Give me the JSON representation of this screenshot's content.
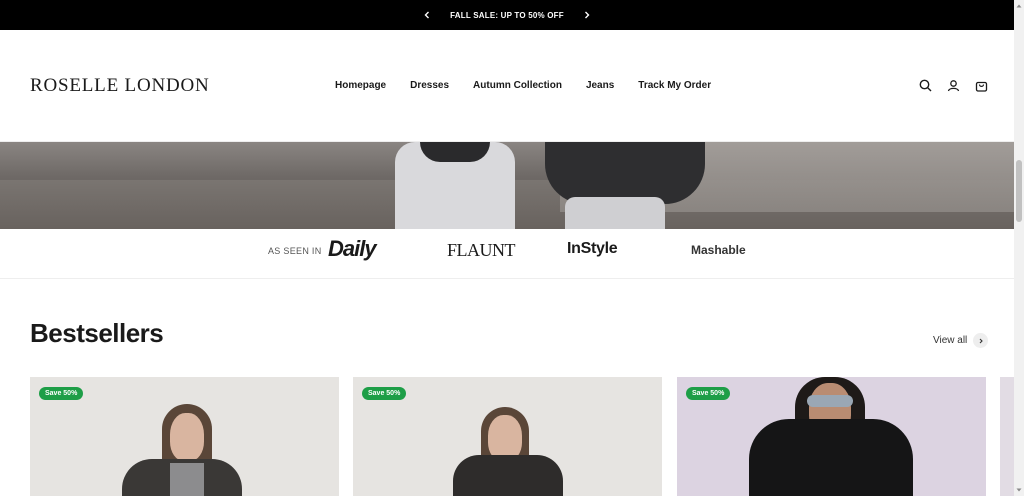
{
  "announcement": {
    "text": "FALL SALE: UP TO 50% OFF",
    "prev_icon": "chevron-left-icon",
    "next_icon": "chevron-right-icon"
  },
  "header": {
    "logo": "ROSELLE LONDON",
    "nav": [
      "Homepage",
      "Dresses",
      "Autumn Collection",
      "Jeans",
      "Track My Order"
    ],
    "icons": [
      "search-icon",
      "account-icon",
      "cart-icon"
    ]
  },
  "press": {
    "label": "AS SEEN IN",
    "logos": [
      "Daily",
      "FLAUNT",
      "InStyle",
      "Mashable"
    ]
  },
  "bestsellers": {
    "title": "Bestsellers",
    "view_all": "View all",
    "products": [
      {
        "badge": "Save 50%"
      },
      {
        "badge": "Save 50%"
      },
      {
        "badge": "Save 50%"
      }
    ]
  },
  "colors": {
    "announcement_bg": "#000000",
    "badge": "#1e9e47",
    "text": "#1a1a1a"
  }
}
